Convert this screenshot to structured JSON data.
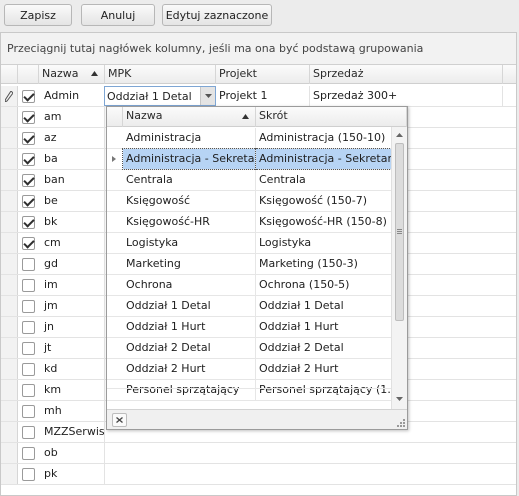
{
  "toolbar": {
    "save": "Zapisz",
    "cancel": "Anuluj",
    "edit": "Edytuj zaznaczone"
  },
  "group_hint": "Przeciągnij tutaj nagłówek kolumny, jeśli ma ona być podstawą grupowania",
  "columns": {
    "name": "Nazwa",
    "mpk": "MPK",
    "project": "Projekt",
    "sales": "Sprzedaż"
  },
  "active_row": {
    "mpk": "Oddział 1 Detal",
    "project": "Projekt 1",
    "sales": "Sprzedaż 300+"
  },
  "rows": [
    {
      "name": "Admin",
      "checked": true
    },
    {
      "name": "am",
      "checked": true
    },
    {
      "name": "az",
      "checked": true
    },
    {
      "name": "ba",
      "checked": true
    },
    {
      "name": "ban",
      "checked": true
    },
    {
      "name": "be",
      "checked": true
    },
    {
      "name": "bk",
      "checked": true
    },
    {
      "name": "cm",
      "checked": true
    },
    {
      "name": "gd",
      "checked": false
    },
    {
      "name": "im",
      "checked": false
    },
    {
      "name": "jm",
      "checked": false
    },
    {
      "name": "jn",
      "checked": false
    },
    {
      "name": "jt",
      "checked": false
    },
    {
      "name": "kd",
      "checked": false
    },
    {
      "name": "km",
      "checked": false
    },
    {
      "name": "mh",
      "checked": false
    },
    {
      "name": "MZZSerwis",
      "checked": false
    },
    {
      "name": "ob",
      "checked": false
    },
    {
      "name": "pk",
      "checked": false
    }
  ],
  "popup": {
    "col_name": "Nazwa",
    "col_short": "Skrót",
    "items": [
      {
        "name": "Administracja",
        "short": "Administracja (150-10)"
      },
      {
        "name": "Administracja - Sekretariat",
        "short": "Administracja - Sekretari…",
        "selected": true
      },
      {
        "name": "Centrala",
        "short": "Centrala"
      },
      {
        "name": "Księgowość",
        "short": "Księgowość (150-7)"
      },
      {
        "name": "Księgowość-HR",
        "short": "Księgowość-HR (150-8)"
      },
      {
        "name": "Logistyka",
        "short": "Logistyka"
      },
      {
        "name": "Marketing",
        "short": "Marketing (150-3)"
      },
      {
        "name": "Ochrona",
        "short": "Ochrona (150-5)"
      },
      {
        "name": "Oddział 1 Detal",
        "short": "Oddział 1 Detal"
      },
      {
        "name": "Oddział 1 Hurt",
        "short": "Oddział 1 Hurt"
      },
      {
        "name": "Oddział 2 Detal",
        "short": "Oddział 2 Detal"
      },
      {
        "name": "Oddział 2 Hurt",
        "short": "Oddział 2 Hurt"
      },
      {
        "name": "Personel sprzątający",
        "short": "Personel sprzątający (1…"
      }
    ]
  }
}
